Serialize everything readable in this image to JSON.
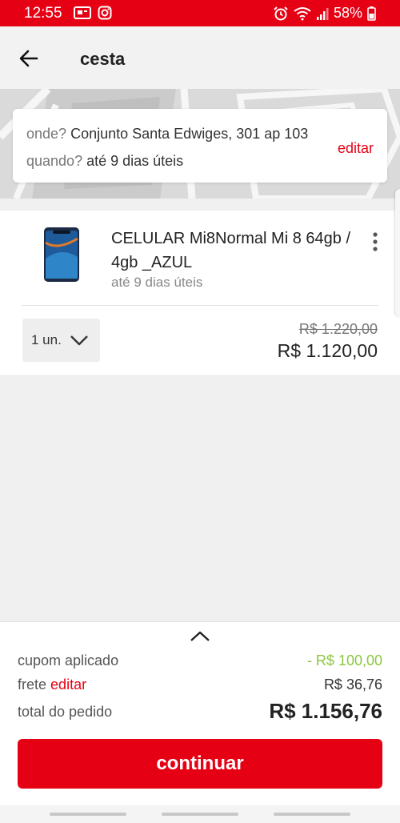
{
  "status_bar": {
    "time": "12:55",
    "battery": "58%",
    "icons": [
      "notification-app-icon",
      "instagram-icon",
      "alarm-icon",
      "wifi-icon",
      "signal-icon",
      "battery-icon"
    ]
  },
  "header": {
    "title": "cesta",
    "back_icon": "arrow-left-icon"
  },
  "delivery": {
    "where_label": "onde?",
    "where_value": "Conjunto Santa Edwiges, 301 ap 103",
    "when_label": "quando?",
    "when_value": "até 9 dias úteis",
    "edit_label": "editar"
  },
  "cart": {
    "items": [
      {
        "name": "CELULAR Mi8Normal Mi 8 64gb / 4gb _AZUL",
        "delivery": "até 9 dias úteis",
        "quantity": "1 un.",
        "old_price": "R$ 1.220,00",
        "price": "R$ 1.120,00"
      }
    ]
  },
  "summary": {
    "coupon_label": "cupom aplicado",
    "coupon_value": "- R$ 100,00",
    "freight_label": "frete",
    "freight_edit": "editar",
    "freight_value": "R$ 36,76",
    "total_label": "total do pedido",
    "total_value": "R$ 1.156,76",
    "continue_label": "continuar"
  },
  "colors": {
    "brand": "#e60014",
    "discount": "#8cc63f"
  }
}
